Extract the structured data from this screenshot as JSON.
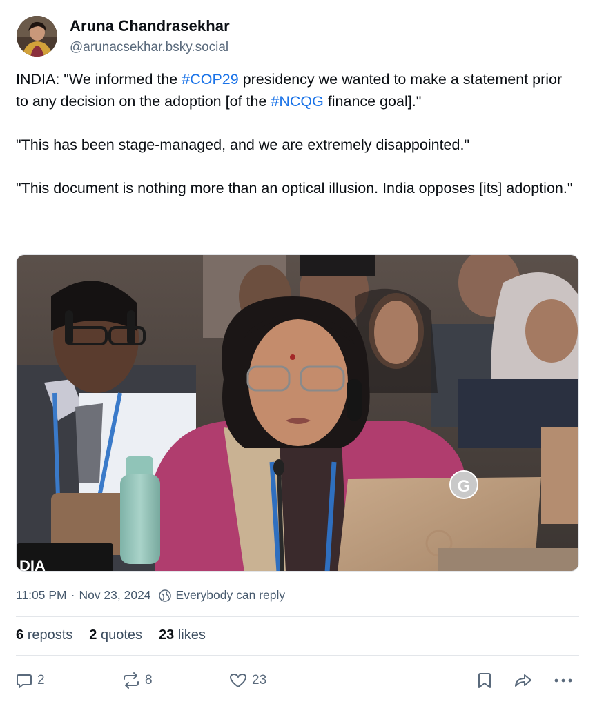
{
  "author": {
    "name": "Aruna Chandrasekhar",
    "handle": "@arunacsekhar.bsky.social"
  },
  "post": {
    "p1": {
      "t1": "INDIA: \"We informed the ",
      "tag1": "#COP29",
      "t2": " presidency we wanted to make a statement prior to any decision on the adoption [of the ",
      "tag2": "#NCQG",
      "t3": " finance goal].\""
    },
    "p2": "\"This has been stage-managed, and we are extremely disappointed.\"",
    "p3": "\"This document is nothing more than an optical illusion. India opposes [its] adoption.\""
  },
  "media": {
    "overlay_letter": "G",
    "placard_text": "DIA"
  },
  "meta": {
    "time": "11:05 PM",
    "separator": "·",
    "date": "Nov 23, 2024",
    "reply_setting": "Everybody can reply"
  },
  "stats": {
    "reposts_count": "6",
    "reposts_label": "reposts",
    "quotes_count": "2",
    "quotes_label": "quotes",
    "likes_count": "23",
    "likes_label": "likes"
  },
  "actions": {
    "reply_count": "2",
    "repost_count": "8",
    "like_count": "23"
  },
  "icons": {
    "reply": "speech-bubble-icon",
    "repost": "repost-arrows-icon",
    "like": "heart-icon",
    "bookmark": "bookmark-icon",
    "share": "share-arrow-icon",
    "more": "ellipsis-icon",
    "globe": "globe-icon"
  },
  "colors": {
    "link": "#1a73e8",
    "muted": "#5a6a7c",
    "text": "#0b0f14"
  }
}
